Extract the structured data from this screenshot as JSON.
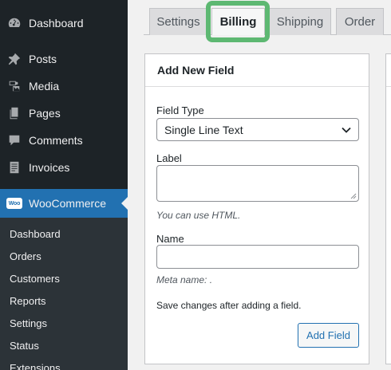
{
  "sidebar": {
    "menu": [
      {
        "label": "Dashboard",
        "icon": "dashboard-icon"
      },
      {
        "label": "Posts",
        "icon": "pin-icon"
      },
      {
        "label": "Media",
        "icon": "media-icon"
      },
      {
        "label": "Pages",
        "icon": "pages-icon"
      },
      {
        "label": "Comments",
        "icon": "comments-icon"
      },
      {
        "label": "Invoices",
        "icon": "invoices-icon"
      }
    ],
    "woocommerce": {
      "label": "WooCommerce",
      "badge": "Woo"
    },
    "submenu": [
      "Dashboard",
      "Orders",
      "Customers",
      "Reports",
      "Settings",
      "Status",
      "Extensions"
    ]
  },
  "tabs": [
    {
      "label": "Settings",
      "active": false
    },
    {
      "label": "Billing",
      "active": true
    },
    {
      "label": "Shipping",
      "active": false
    },
    {
      "label": "Order",
      "active": false
    }
  ],
  "panel": {
    "title": "Add New Field",
    "field_type_label": "Field Type",
    "field_type_value": "Single Line Text",
    "label_label": "Label",
    "label_hint": "You can use HTML.",
    "name_label": "Name",
    "name_hint": "Meta name: .",
    "save_note": "Save changes after adding a field.",
    "add_button": "Add Field"
  },
  "colors": {
    "sidebar_bg": "#1d2327",
    "submenu_bg": "#2c3338",
    "accent": "#2271b1",
    "highlight": "#5db872"
  }
}
